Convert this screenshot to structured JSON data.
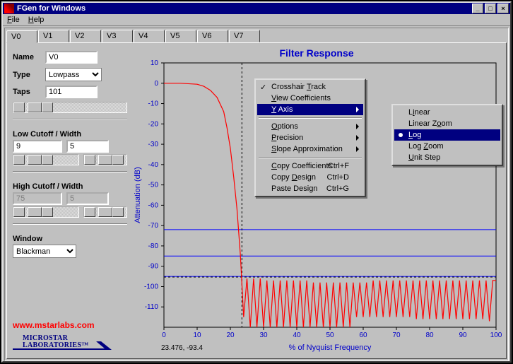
{
  "title": "FGen for Windows",
  "menubar": {
    "file": "File",
    "help": "Help"
  },
  "tabs": [
    "V0",
    "V1",
    "V2",
    "V3",
    "V4",
    "V5",
    "V6",
    "V7"
  ],
  "active_tab": 0,
  "sidebar": {
    "name_label": "Name",
    "name_value": "V0",
    "type_label": "Type",
    "type_value": "Lowpass",
    "taps_label": "Taps",
    "taps_value": "101",
    "low_cutoff_label": "Low Cutoff / Width",
    "low_cutoff_value": "9",
    "low_width_value": "5",
    "high_cutoff_label": "High Cutoff / Width",
    "high_cutoff_value": "75",
    "high_width_value": "5",
    "window_label": "Window",
    "window_value": "Blackman",
    "brand_url": "www.mstarlabs.com",
    "logo_line1": "MICROSTAR",
    "logo_line2": "LABORATORIES™"
  },
  "chart_title": "Filter Response",
  "chart_ylabel": "Attenuation (dB)",
  "chart_xlabel": "% of Nyquist Frequency",
  "cursor_readout": "23.476, -93.4",
  "context_menu": {
    "items": [
      {
        "label": "Crosshair Track",
        "checked": true,
        "u": "T"
      },
      {
        "label": "View Coefficients",
        "u": "V"
      },
      {
        "label": "Y Axis",
        "submenu": true,
        "selected": true,
        "u": "Y"
      },
      {
        "label": "Options",
        "submenu": true,
        "u": "O"
      },
      {
        "label": "Precision",
        "submenu": true,
        "u": "P"
      },
      {
        "label": "Slope Approximation",
        "submenu": true,
        "u": "S"
      },
      {
        "label": "Copy Coefficients",
        "shortcut": "Ctrl+F",
        "u": "C"
      },
      {
        "label": "Copy Design",
        "shortcut": "Ctrl+D",
        "u": "D"
      },
      {
        "label": "Paste Design",
        "shortcut": "Ctrl+G"
      }
    ],
    "submenu": [
      {
        "label": "Linear",
        "u": "i"
      },
      {
        "label": "Linear Zoom",
        "u": "o"
      },
      {
        "label": "Log",
        "selected": true,
        "radio": true,
        "u": "L"
      },
      {
        "label": "Log Zoom",
        "u": "Z"
      },
      {
        "label": "Unit Step",
        "u": "U"
      }
    ]
  },
  "chart_data": {
    "type": "line",
    "title": "Filter Response",
    "xlabel": "% of Nyquist Frequency",
    "ylabel": "Attenuation (dB)",
    "xlim": [
      0,
      100
    ],
    "ylim": [
      -120,
      10
    ],
    "yticks": [
      10,
      0,
      -10,
      -20,
      -30,
      -40,
      -50,
      -60,
      -70,
      -80,
      -90,
      -100,
      -110
    ],
    "xticks": [
      0,
      10,
      20,
      30,
      40,
      50,
      60,
      70,
      80,
      90,
      100
    ],
    "hlines": [
      -72,
      -85,
      -95
    ],
    "vlines": [
      23.476
    ],
    "guide_hline": -95.3,
    "series": [
      {
        "name": "response",
        "color": "#ff0000",
        "x": [
          0,
          5,
          10,
          12,
          14,
          16,
          18,
          19,
          20,
          21,
          22,
          23,
          24,
          25,
          26,
          27,
          28,
          29,
          30,
          31,
          32,
          33,
          34,
          35,
          36,
          37,
          38,
          39,
          40,
          41,
          42,
          43,
          44,
          45,
          46,
          47,
          48,
          49,
          50,
          51,
          52,
          53,
          54,
          55,
          56,
          57,
          58,
          59,
          60,
          61,
          62,
          63,
          64,
          65,
          66,
          67,
          68,
          69,
          70,
          71,
          72,
          73,
          74,
          75,
          76,
          77,
          78,
          79,
          80,
          81,
          82,
          83,
          84,
          85,
          86,
          87,
          88,
          89,
          90,
          91,
          92,
          93,
          94,
          95,
          96,
          97,
          98,
          99,
          100
        ],
        "y": [
          0,
          0,
          -0.5,
          -1.5,
          -3.5,
          -7,
          -14,
          -22,
          -32,
          -46,
          -62,
          -84,
          -115,
          -96,
          -120,
          -96,
          -120,
          -96,
          -120,
          -97,
          -120,
          -97,
          -120,
          -97,
          -120,
          -97,
          -120,
          -97,
          -120,
          -97,
          -120,
          -97,
          -120,
          -98,
          -120,
          -98,
          -120,
          -98,
          -120,
          -98,
          -120,
          -98,
          -120,
          -98,
          -120,
          -98,
          -115,
          -98,
          -115,
          -98,
          -115,
          -97,
          -115,
          -97,
          -115,
          -97,
          -115,
          -97,
          -115,
          -97,
          -115,
          -97,
          -115,
          -97,
          -116,
          -97,
          -116,
          -97,
          -116,
          -97,
          -116,
          -97,
          -116,
          -97,
          -116,
          -97,
          -116,
          -97,
          -116,
          -97,
          -116,
          -97,
          -116,
          -97,
          -116,
          -97,
          -117,
          -97,
          -97
        ]
      }
    ]
  }
}
